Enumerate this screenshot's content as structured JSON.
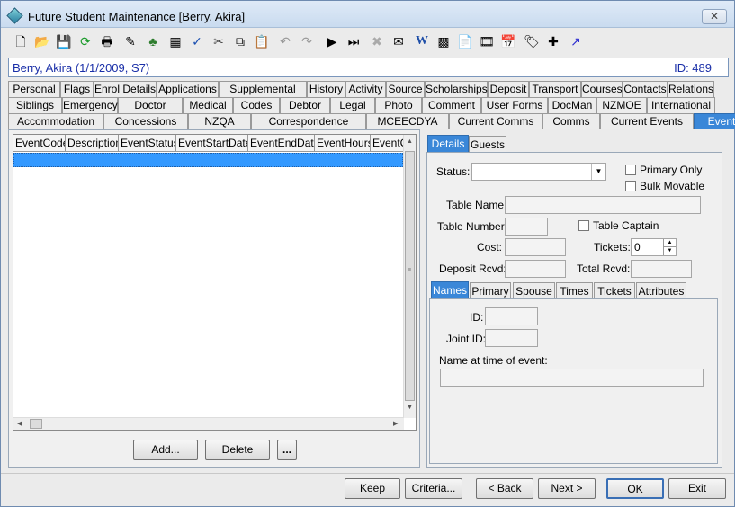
{
  "window": {
    "title": "Future Student Maintenance  [Berry, Akira]"
  },
  "toolbar": {
    "icons": [
      "new-document-icon",
      "open-folder-icon",
      "save-icon",
      "refresh-icon",
      "print-icon",
      "edit-icon",
      "tree-icon",
      "calculator-icon",
      "spellcheck-icon",
      "cut-icon",
      "copy-icon",
      "paste-icon",
      "undo-icon",
      "redo-icon",
      "play-next-icon",
      "play-last-icon",
      "delete-icon",
      "email-icon",
      "word-icon",
      "grid-icon",
      "clipboard-icon",
      "film-icon",
      "calendar-icon",
      "tag-icon",
      "add-note-icon",
      "arrow-icon"
    ]
  },
  "header": {
    "name": "Berry, Akira (1/1/2009, S7)",
    "id": "ID: 489"
  },
  "tabs": {
    "row1": [
      "Personal",
      "Flags",
      "Enrol Details",
      "Applications",
      "Supplemental",
      "History",
      "Activity",
      "Source",
      "Scholarships",
      "Deposit",
      "Transport",
      "Courses",
      "Contacts",
      "Relations"
    ],
    "row2": [
      "Siblings",
      "Emergency",
      "Doctor",
      "Medical",
      "Codes",
      "Debtor",
      "Legal",
      "Photo",
      "Comment",
      "User Forms",
      "DocMan",
      "NZMOE",
      "International"
    ],
    "row3": [
      "Accommodation",
      "Concessions",
      "NZQA",
      "Correspondence",
      "MCEECDYA",
      "Current Comms",
      "Comms",
      "Current Events",
      "Events"
    ],
    "active": "Events"
  },
  "grid": {
    "columns": [
      "EventCode",
      "Description",
      "EventStatus",
      "EventStartDate",
      "EventEndDate",
      "EventHours",
      "EventC"
    ]
  },
  "left_buttons": {
    "add": "Add...",
    "delete": "Delete",
    "more": "..."
  },
  "right_tabs": [
    "Details",
    "Guests"
  ],
  "details": {
    "status_label": "Status:",
    "status_value": "",
    "primary_only_label": "Primary Only",
    "bulk_movable_label": "Bulk Movable",
    "table_name_label": "Table Name:",
    "table_number_label": "Table Number:",
    "table_captain_label": "Table Captain",
    "cost_label": "Cost:",
    "tickets_label": "Tickets:",
    "tickets_value": "0",
    "deposit_label": "Deposit Rcvd:",
    "total_label": "Total Rcvd:"
  },
  "sub_tabs": [
    "Names",
    "Primary",
    "Spouse",
    "Times",
    "Tickets",
    "Attributes"
  ],
  "names": {
    "id_label": "ID:",
    "joint_id_label": "Joint ID:",
    "name_at_time_label": "Name at time of event:"
  },
  "bottom_buttons": {
    "keep": "Keep",
    "criteria": "Criteria...",
    "back": "< Back",
    "next": "Next >",
    "ok": "OK",
    "exit": "Exit"
  }
}
